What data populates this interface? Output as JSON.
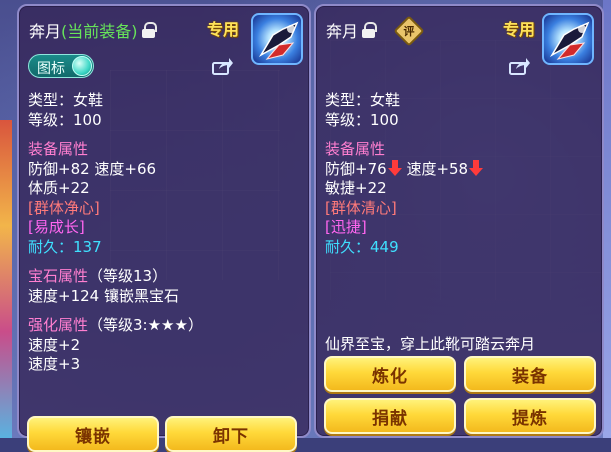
{
  "left": {
    "name": "奔月",
    "equipped": "(当前装备)",
    "special": "专用",
    "toggle_label": "图标",
    "type_line": "类型：女鞋",
    "level_line": "等级：100",
    "equip_attr_title": "装备属性",
    "attr_line1": "防御+82 速度+66",
    "attr_line2": "体质+22",
    "effect1": "[群体净心]",
    "effect2": "[易成长]",
    "durability": "耐久：137",
    "gem_title": "宝石属性",
    "gem_level": "（等级13）",
    "gem_line": "速度+124 镶嵌黑宝石",
    "enhance_title": "强化属性",
    "enhance_level": "（等级3:★★★）",
    "enhance_line1": "速度+2",
    "enhance_line2": "速度+3",
    "buttons": [
      "镶嵌",
      "卸下"
    ]
  },
  "right": {
    "name": "奔月",
    "rating": "评",
    "special": "专用",
    "type_line": "类型：女鞋",
    "level_line": "等级：100",
    "equip_attr_title": "装备属性",
    "attr_defense": "防御+76",
    "attr_speed": "速度+58",
    "attr_line2": "敏捷+22",
    "effect1": "[群体清心]",
    "effect2": "[迅捷]",
    "durability": "耐久：449",
    "description": "仙界至宝，穿上此靴可踏云奔月",
    "buttons": [
      "炼化",
      "装备",
      "捐献",
      "提炼"
    ]
  },
  "colors": {
    "equipped": "#67e45a",
    "section": "#ff7fd0",
    "effect_red": "#ff7a7a",
    "effect_purple": "#ff66f0",
    "durability": "#3fe0ff",
    "special": "#ffe35a",
    "button": "#ffd93a"
  },
  "icons": [
    "lock-icon",
    "share-icon",
    "item-icon",
    "down-arrow-icon",
    "rating-badge-icon"
  ]
}
